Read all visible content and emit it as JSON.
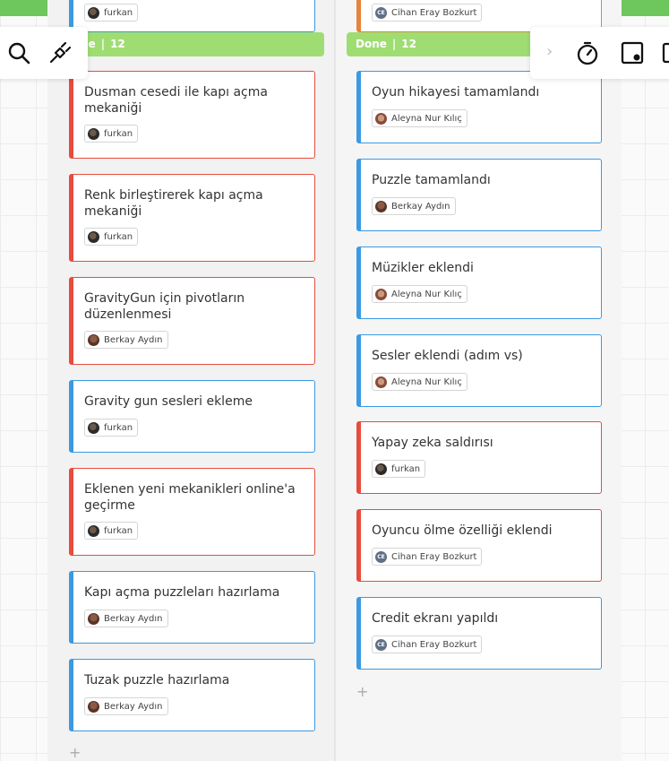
{
  "columns": [
    {
      "header": {
        "name": "ne",
        "count": "12"
      },
      "cards": [
        {
          "title": "Dusman cesedi ile kapı açma mekaniği",
          "assignee": "furkan",
          "avatar": "furkan",
          "color": "red"
        },
        {
          "title": "Renk birleştirerek kapı açma mekaniği",
          "assignee": "furkan",
          "avatar": "furkan",
          "color": "red"
        },
        {
          "title": "GravityGun için pivotların düzenlenmesi",
          "assignee": "Berkay Aydın",
          "avatar": "berkay",
          "color": "red"
        },
        {
          "title": "Gravity gun sesleri ekleme",
          "assignee": "furkan",
          "avatar": "furkan",
          "color": "blue"
        },
        {
          "title": "Eklenen yeni mekanikleri online'a geçirme",
          "assignee": "furkan",
          "avatar": "furkan",
          "color": "red"
        },
        {
          "title": "Kapı açma puzzleları hazırlama",
          "assignee": "Berkay Aydın",
          "avatar": "berkay",
          "color": "blue"
        },
        {
          "title": "Tuzak puzzle hazırlama",
          "assignee": "Berkay Aydın",
          "avatar": "berkay",
          "color": "blue"
        }
      ],
      "partial_top_chip": "furkan"
    },
    {
      "header": {
        "name": "Done",
        "count": "12"
      },
      "cards": [
        {
          "title": "Oyun hikayesi tamamlandı",
          "assignee": "Aleyna Nur Kılıç",
          "avatar": "aleyna",
          "color": "blue"
        },
        {
          "title": "Puzzle tamamlandı",
          "assignee": "Berkay Aydın",
          "avatar": "berkay",
          "color": "blue"
        },
        {
          "title": "Müzikler eklendi",
          "assignee": "Aleyna Nur Kılıç",
          "avatar": "aleyna",
          "color": "blue"
        },
        {
          "title": "Sesler eklendi (adım vs)",
          "assignee": "Aleyna Nur Kılıç",
          "avatar": "aleyna",
          "color": "blue"
        },
        {
          "title": "Yapay zeka saldırısı",
          "assignee": "furkan",
          "avatar": "furkan",
          "color": "red"
        },
        {
          "title": "Oyuncu ölme özelliği eklendi",
          "assignee": "Cihan Eray Bozkurt",
          "avatar": "cihan",
          "color": "red"
        },
        {
          "title": "Credit ekranı yapıldı",
          "assignee": "Cihan Eray Bozkurt",
          "avatar": "cihan",
          "color": "blue"
        }
      ],
      "partial_top_chip": "Cihan Eray Bozkurt"
    }
  ],
  "avatar_initials": {
    "cihan": "CE"
  },
  "header_separator": "|",
  "add_symbol": "+",
  "chevron_symbol": "›",
  "colors": {
    "topbar": "#6dc75d",
    "header": "#9fdd73",
    "red": "#e74c3c",
    "blue": "#3b9ae1"
  },
  "icons": [
    "search-icon",
    "plug-icon",
    "chevron-right-icon",
    "timer-icon",
    "sticky-note-icon",
    "panel-icon"
  ]
}
